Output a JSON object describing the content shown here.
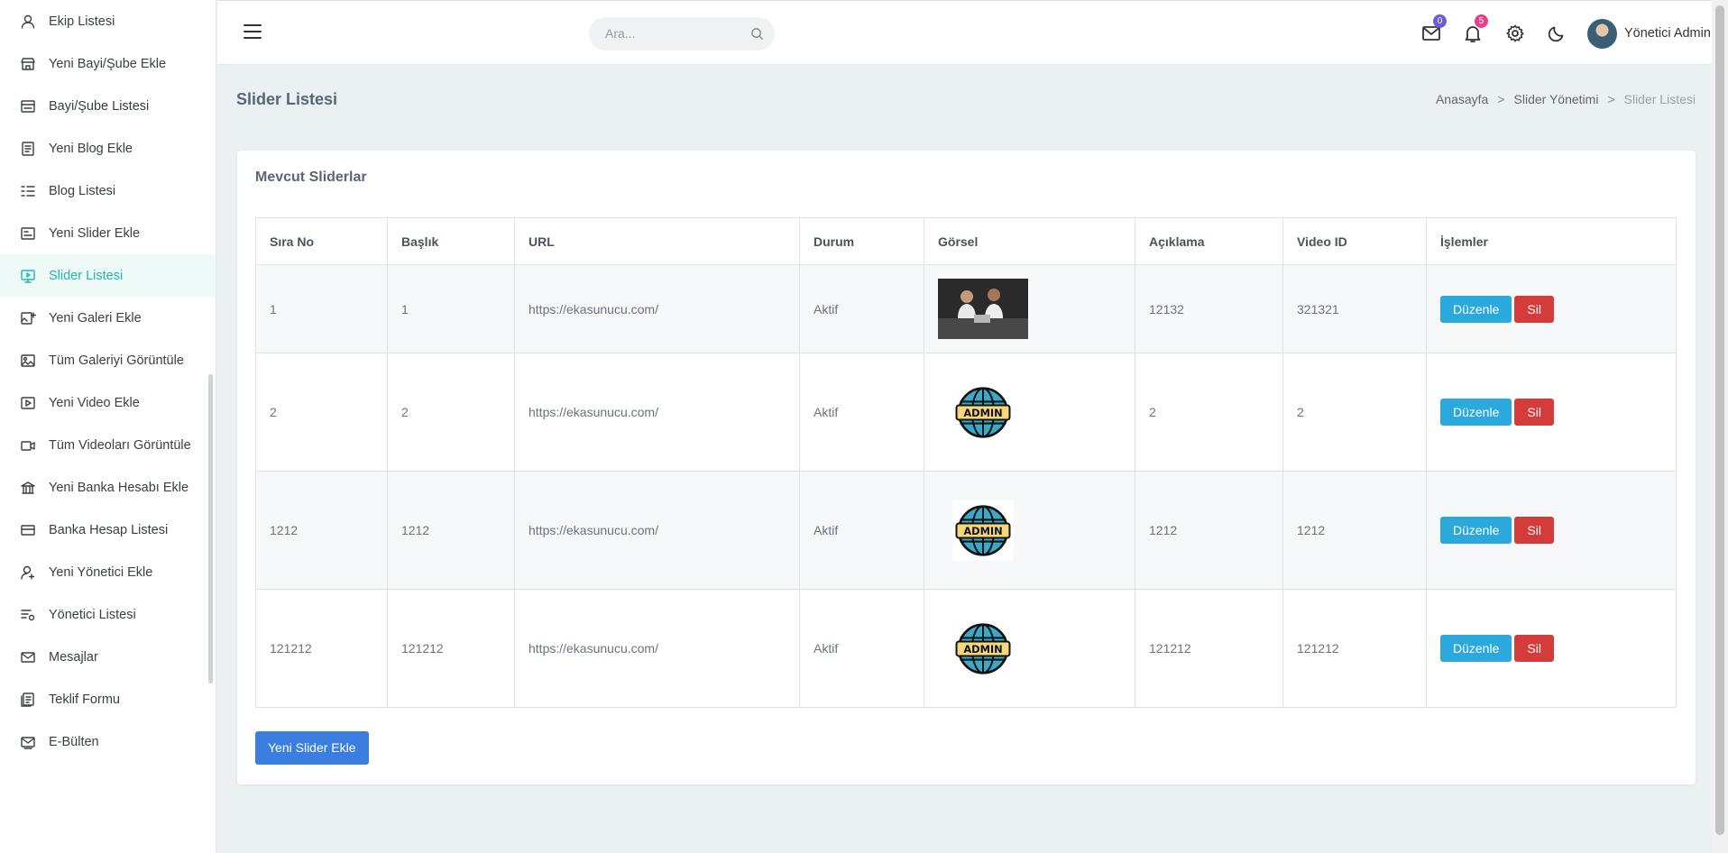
{
  "sidebar": {
    "items": [
      {
        "label": "Ekip Listesi",
        "icon": "user-icon"
      },
      {
        "label": "Yeni Bayi/Şube Ekle",
        "icon": "store-icon"
      },
      {
        "label": "Bayi/Şube Listesi",
        "icon": "store-list-icon"
      },
      {
        "label": "Yeni Blog Ekle",
        "icon": "document-icon"
      },
      {
        "label": "Blog Listesi",
        "icon": "list-icon"
      },
      {
        "label": "Yeni Slider Ekle",
        "icon": "slider-icon"
      },
      {
        "label": "Slider Listesi",
        "icon": "monitor-icon",
        "active": true
      },
      {
        "label": "Yeni Galeri Ekle",
        "icon": "gallery-add-icon"
      },
      {
        "label": "Tüm Galeriyi Görüntüle",
        "icon": "image-icon"
      },
      {
        "label": "Yeni Video Ekle",
        "icon": "video-icon"
      },
      {
        "label": "Tüm Videoları Görüntüle",
        "icon": "video-camera-icon"
      },
      {
        "label": "Yeni Banka Hesabı Ekle",
        "icon": "bank-icon"
      },
      {
        "label": "Banka Hesap Listesi",
        "icon": "card-icon"
      },
      {
        "label": "Yeni Yönetici Ekle",
        "icon": "user-add-icon"
      },
      {
        "label": "Yönetici Listesi",
        "icon": "user-list-icon"
      },
      {
        "label": "Mesajlar",
        "icon": "mail-icon"
      },
      {
        "label": "Teklif Formu",
        "icon": "form-icon"
      },
      {
        "label": "E-Bülten",
        "icon": "newsletter-icon"
      }
    ]
  },
  "topbar": {
    "search_placeholder": "Ara...",
    "mail_badge": "0",
    "notification_badge": "5",
    "username": "Yönetici Admin"
  },
  "page": {
    "title": "Slider Listesi",
    "breadcrumb": [
      "Anasayfa",
      "Slider Yönetimi",
      "Slider Listesi"
    ]
  },
  "card": {
    "title": "Mevcut Sliderlar",
    "add_button": "Yeni Slider Ekle"
  },
  "table": {
    "headers": [
      "Sıra No",
      "Başlık",
      "URL",
      "Durum",
      "Görsel",
      "Açıklama",
      "Video ID",
      "İşlemler"
    ],
    "rows": [
      {
        "no": "1",
        "title": "1",
        "url": "https://ekasunucu.com/",
        "status": "Aktif",
        "image": "photo",
        "description": "12132",
        "video_id": "321321",
        "edit": "Düzenle",
        "delete": "Sil"
      },
      {
        "no": "2",
        "title": "2",
        "url": "https://ekasunucu.com/",
        "status": "Aktif",
        "image": "admin",
        "description": "2",
        "video_id": "2",
        "edit": "Düzenle",
        "delete": "Sil"
      },
      {
        "no": "1212",
        "title": "1212",
        "url": "https://ekasunucu.com/",
        "status": "Aktif",
        "image": "admin",
        "description": "1212",
        "video_id": "1212",
        "edit": "Düzenle",
        "delete": "Sil"
      },
      {
        "no": "121212",
        "title": "121212",
        "url": "https://ekasunucu.com/",
        "status": "Aktif",
        "image": "admin",
        "description": "121212",
        "video_id": "121212",
        "edit": "Düzenle",
        "delete": "Sil"
      }
    ],
    "admin_logo_text": "ADMIN"
  },
  "colors": {
    "accent": "#20b7a6",
    "edit": "#2ba8dc",
    "delete": "#d43c3c",
    "primary": "#3a7fe0",
    "mail_badge": "#6f5bd6",
    "notification_badge": "#e83e8c"
  }
}
